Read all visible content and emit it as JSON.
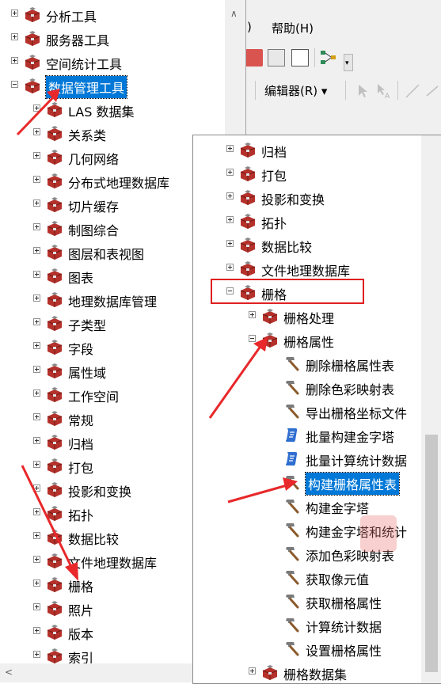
{
  "menu": {
    "partial": ")",
    "help": "帮助(H)"
  },
  "toolbar2": {
    "editor_label": "编辑器(R) ▾"
  },
  "left_tree": [
    {
      "label": "分析工具",
      "level": 0,
      "expand": "plus"
    },
    {
      "label": "服务器工具",
      "level": 0,
      "expand": "plus"
    },
    {
      "label": "空间统计工具",
      "level": 0,
      "expand": "plus"
    },
    {
      "label": "数据管理工具",
      "level": 0,
      "expand": "minus",
      "selected": true
    },
    {
      "label": "LAS 数据集",
      "level": 1,
      "expand": "plus"
    },
    {
      "label": "关系类",
      "level": 1,
      "expand": "plus"
    },
    {
      "label": "几何网络",
      "level": 1,
      "expand": "plus"
    },
    {
      "label": "分布式地理数据库",
      "level": 1,
      "expand": "plus"
    },
    {
      "label": "切片缓存",
      "level": 1,
      "expand": "plus"
    },
    {
      "label": "制图综合",
      "level": 1,
      "expand": "plus"
    },
    {
      "label": "图层和表视图",
      "level": 1,
      "expand": "plus"
    },
    {
      "label": "图表",
      "level": 1,
      "expand": "plus"
    },
    {
      "label": "地理数据库管理",
      "level": 1,
      "expand": "plus"
    },
    {
      "label": "子类型",
      "level": 1,
      "expand": "plus"
    },
    {
      "label": "字段",
      "level": 1,
      "expand": "plus"
    },
    {
      "label": "属性域",
      "level": 1,
      "expand": "plus"
    },
    {
      "label": "工作空间",
      "level": 1,
      "expand": "plus"
    },
    {
      "label": "常规",
      "level": 1,
      "expand": "plus"
    },
    {
      "label": "归档",
      "level": 1,
      "expand": "plus"
    },
    {
      "label": "打包",
      "level": 1,
      "expand": "plus"
    },
    {
      "label": "投影和变换",
      "level": 1,
      "expand": "plus"
    },
    {
      "label": "拓扑",
      "level": 1,
      "expand": "plus"
    },
    {
      "label": "数据比较",
      "level": 1,
      "expand": "plus"
    },
    {
      "label": "文件地理数据库",
      "level": 1,
      "expand": "plus"
    },
    {
      "label": "栅格",
      "level": 1,
      "expand": "plus"
    },
    {
      "label": "照片",
      "level": 1,
      "expand": "plus"
    },
    {
      "label": "版本",
      "level": 1,
      "expand": "plus"
    },
    {
      "label": "索引",
      "level": 1,
      "expand": "plus"
    }
  ],
  "right_tree": [
    {
      "label": "归档",
      "type": "toolbox",
      "expand": "plus",
      "level": 0
    },
    {
      "label": "打包",
      "type": "toolbox",
      "expand": "plus",
      "level": 0
    },
    {
      "label": "投影和变换",
      "type": "toolbox",
      "expand": "plus",
      "level": 0
    },
    {
      "label": "拓扑",
      "type": "toolbox",
      "expand": "plus",
      "level": 0
    },
    {
      "label": "数据比较",
      "type": "toolbox",
      "expand": "plus",
      "level": 0
    },
    {
      "label": "文件地理数据库",
      "type": "toolbox",
      "expand": "plus",
      "level": 0
    },
    {
      "label": "栅格",
      "type": "toolbox",
      "expand": "minus",
      "level": 0
    },
    {
      "label": "栅格处理",
      "type": "toolbox",
      "expand": "plus",
      "level": 1
    },
    {
      "label": "栅格属性",
      "type": "toolbox",
      "expand": "minus",
      "level": 1
    },
    {
      "label": "删除栅格属性表",
      "type": "hammer",
      "level": 2
    },
    {
      "label": "删除色彩映射表",
      "type": "hammer",
      "level": 2
    },
    {
      "label": "导出栅格坐标文件",
      "type": "hammer",
      "level": 2
    },
    {
      "label": "批量构建金字塔",
      "type": "script",
      "level": 2
    },
    {
      "label": "批量计算统计数据",
      "type": "script",
      "level": 2
    },
    {
      "label": "构建栅格属性表",
      "type": "hammer",
      "level": 2,
      "selected": true
    },
    {
      "label": "构建金字塔",
      "type": "hammer",
      "level": 2
    },
    {
      "label": "构建金字塔和统计",
      "type": "hammer",
      "level": 2
    },
    {
      "label": "添加色彩映射表",
      "type": "hammer",
      "level": 2
    },
    {
      "label": "获取像元值",
      "type": "hammer",
      "level": 2
    },
    {
      "label": "获取栅格属性",
      "type": "hammer",
      "level": 2
    },
    {
      "label": "计算统计数据",
      "type": "hammer",
      "level": 2
    },
    {
      "label": "设置栅格属性",
      "type": "hammer",
      "level": 2
    },
    {
      "label": "栅格数据集",
      "type": "toolbox",
      "expand": "plus",
      "level": 1
    }
  ],
  "colors": {
    "selection": "#0078d7",
    "highlight_box": "#e02020",
    "arrow": "#e8282a"
  }
}
